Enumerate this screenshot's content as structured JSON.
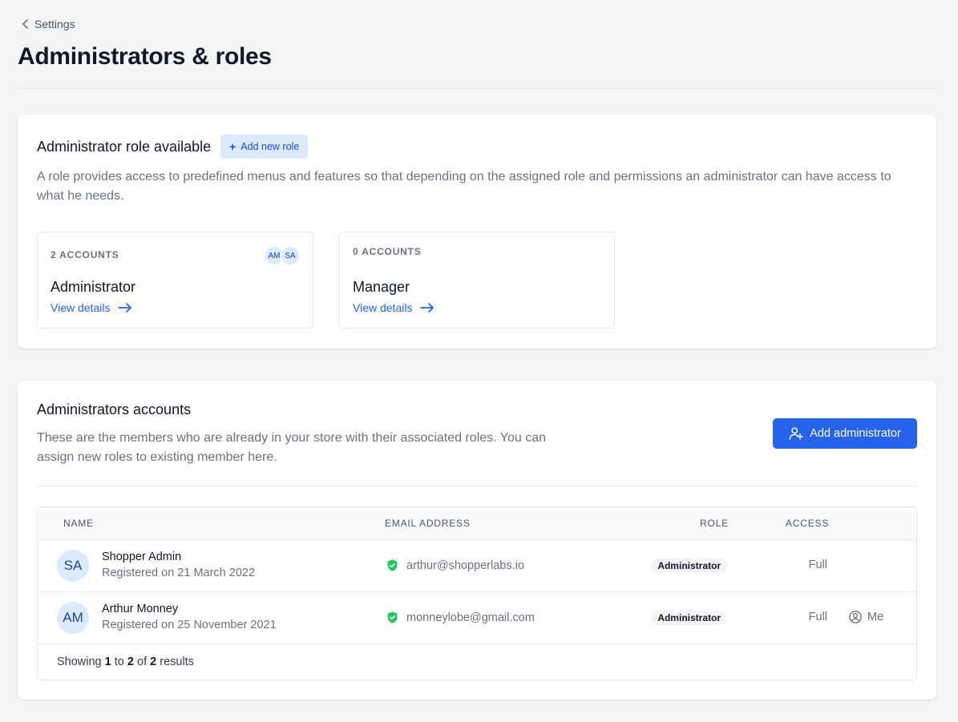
{
  "breadcrumb": {
    "label": "Settings"
  },
  "page": {
    "title": "Administrators & roles"
  },
  "roles_section": {
    "title": "Administrator role available",
    "add_button": "Add new role",
    "description": "A role provides access to predefined menus and features so that depending on the assigned role and permissions an administrator can have access to what he needs.",
    "roles": [
      {
        "count_label": "2 ACCOUNTS",
        "name": "Administrator",
        "link": "View details",
        "avatars": [
          "AM",
          "SA"
        ]
      },
      {
        "count_label": "0 ACCOUNTS",
        "name": "Manager",
        "link": "View details",
        "avatars": []
      }
    ]
  },
  "admins_section": {
    "title": "Administrators accounts",
    "description": "These are the members who are already in your store with their associated roles. You can assign new roles to existing member here.",
    "add_button": "Add administrator",
    "columns": {
      "name": "NAME",
      "email": "EMAIL ADDRESS",
      "role": "ROLE",
      "access": "ACCESS"
    },
    "rows": [
      {
        "initials": "SA",
        "name": "Shopper Admin",
        "registered": "Registered on 21 March 2022",
        "email": "arthur@shopperlabs.io",
        "role": "Administrator",
        "access": "Full",
        "tag": ""
      },
      {
        "initials": "AM",
        "name": "Arthur Monney",
        "registered": "Registered on 25 November 2021",
        "email": "monneylobe@gmail.com",
        "role": "Administrator",
        "access": "Full",
        "tag": "Me"
      }
    ],
    "footer": {
      "prefix": "Showing",
      "from": "1",
      "to_word": "to",
      "to": "2",
      "of_word": "of",
      "total": "2",
      "suffix": "results"
    }
  },
  "colors": {
    "accent": "#2563eb",
    "accent_light": "#dbeafe",
    "verified": "#22c55e",
    "muted_text": "#6b7280"
  },
  "icons": {
    "back": "chevron-left-icon",
    "plus": "plus-icon",
    "arrow": "arrow-right-icon",
    "add_user": "user-plus-icon",
    "verified": "shield-check-icon",
    "me": "user-circle-icon"
  }
}
